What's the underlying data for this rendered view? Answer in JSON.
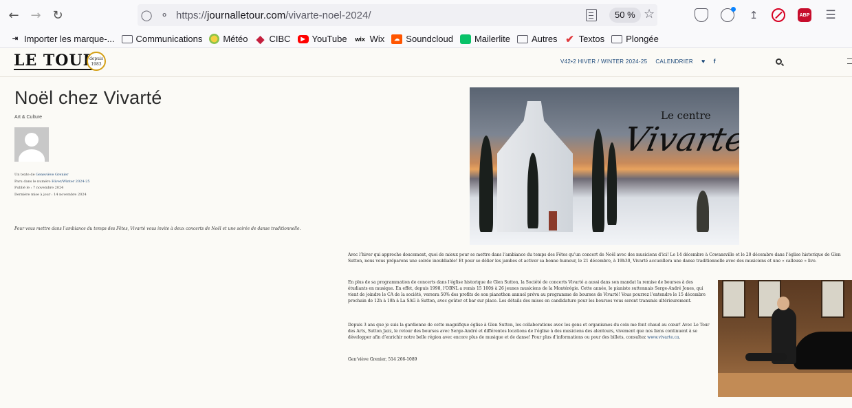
{
  "browser": {
    "back_icon": "back-arrow-icon",
    "forward_icon": "forward-arrow-icon",
    "reload_icon": "reload-icon",
    "url_prefix": "https://",
    "url_host": "journalletour.com",
    "url_path": "/vivarte-noel-2024/",
    "zoom": "50 %",
    "abp_label": "ABP"
  },
  "bookmarks": [
    {
      "label": "Importer les marque-...",
      "icon": "import-icon"
    },
    {
      "label": "Communications",
      "icon": "folder-icon"
    },
    {
      "label": "Météo",
      "icon": "meteo-icon"
    },
    {
      "label": "CIBC",
      "icon": "cibc-icon"
    },
    {
      "label": "YouTube",
      "icon": "youtube-icon"
    },
    {
      "label": "Wix",
      "icon": "wix-icon"
    },
    {
      "label": "Soundcloud",
      "icon": "soundcloud-icon"
    },
    {
      "label": "Mailerlite",
      "icon": "mailerlite-icon"
    },
    {
      "label": "Autres",
      "icon": "folder-icon"
    },
    {
      "label": "Textos",
      "icon": "textos-icon"
    },
    {
      "label": "Plongée",
      "icon": "folder-icon"
    }
  ],
  "site": {
    "logo": "LE TOUR",
    "logo_badge_line1": "depuis",
    "logo_badge_line2": "1983",
    "nav_issue": "V42•2 HIVER / WINTER 2024-25",
    "nav_calendar": "CALENDRIER",
    "fb_label": "f"
  },
  "article": {
    "title": "Noël chez Vivarté",
    "category": "Art & Culture",
    "meta_author_prefix": "Un texte de ",
    "meta_author": "Geneviève Grenier",
    "meta_issue_prefix": "Paru dans le numéro ",
    "meta_issue": "Hiver/Winter 2024-25",
    "meta_published": "Publié le : 7 novembre 2024",
    "meta_updated": "Dernière mise à jour : 14 novembre 2024",
    "lede": "Pour vous mettre dans l’ambiance du temps des Fêtes, Vivarté vous invite à deux concerts de Noël et une soirée de danse traditionnelle.",
    "hero_caption_small": "Le centre",
    "hero_caption_big": "Vivarte",
    "p1": "Avec l’hiver qui approche doucement, quoi de mieux pour se mettre dans l’ambiance du temps des Fêtes qu’un concert de Noël avec des musiciens d’ici! Le 14 décembre à Cowansville et le 20 décembre dans l’église historique de Glen Sutton, nous vous préparons une soirée inoubliable! Et pour se délier les jambes et activer sa bonne humeur, le 21 décembre, à 19h30, Vivarté accueillera une danse traditionnelle avec des musiciens et une « calleuse » live.",
    "p2": "En plus de sa programmation de concerts dans l’église historique de Glen Sutton, la Société de concerts Vivarté a aussi dans son mandat la remise de bourses à des étudiants en musique. En effet, depuis 1998, l’OBNL a remis 15 100$ à 26 jeunes musiciens de la Montérégie. Cette année, le pianiste suttonnais Serge-André Jones, qui vient de joindre le CA de la société, versera 50% des profits de son pianothon annuel prévu au programme de bourses de Vivarté! Vous pourrez l’entendre le 15 décembre prochain de 12h à 18h à La SAG à Sutton, avec goûter et bar sur place. Les détails des mises en candidature pour les bourses vous seront transmis ultérieurement.",
    "p3": "Depuis 3 ans que je suis la gardienne de cette magnifique église à Glen Sutton, les collaborations avec les gens et organismes du coin me font chaud au cœur! Avec Le Tour des Arts, Sutton Jazz, le retour des bourses avec Serge-André et différentes locations de l’église à des musiciens des alentours, vivement que nos liens continuent à se développer afin d’enrichir notre belle région avec encore plus de musique et de danse! Pour plus d’informations ou pour des billets, consultez ",
    "p3_link": "www.vivarte.ca",
    "p3_end": ".",
    "p4": "Gen’viève Grenier, 514 266-1089"
  }
}
